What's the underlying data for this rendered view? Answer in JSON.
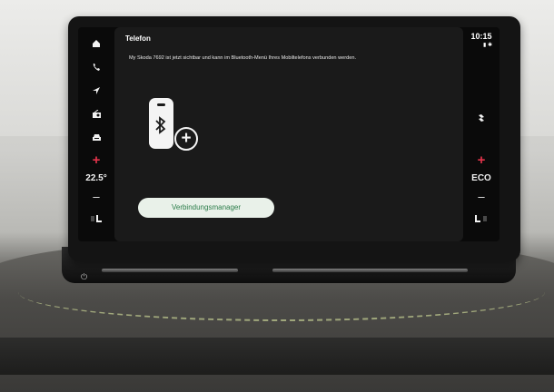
{
  "app": {
    "title": "Telefon",
    "message": "My Skoda 7692 ist jetzt sichtbar und kann im Bluetooth-Menü Ihres Mobiltelefons verbunden werden.",
    "button_label": "Verbindungsmanager"
  },
  "status": {
    "time": "10:15"
  },
  "left_rail": {
    "temperature": "22.5°",
    "plus": "+",
    "minus": "–"
  },
  "right_rail": {
    "mode": "ECO",
    "plus": "+",
    "minus": "–"
  },
  "icons": [
    "home-icon",
    "phone-icon",
    "navigation-icon",
    "radio-icon",
    "car-icon",
    "seat-heat-icon",
    "fan-icon",
    "bluetooth-icon",
    "add-icon",
    "power-icon"
  ],
  "colors": {
    "accent_red": "#e3344b",
    "button_text": "#2c7d4a",
    "button_bg": "#e9f1e9",
    "screen_bg": "#0a0a0a"
  }
}
